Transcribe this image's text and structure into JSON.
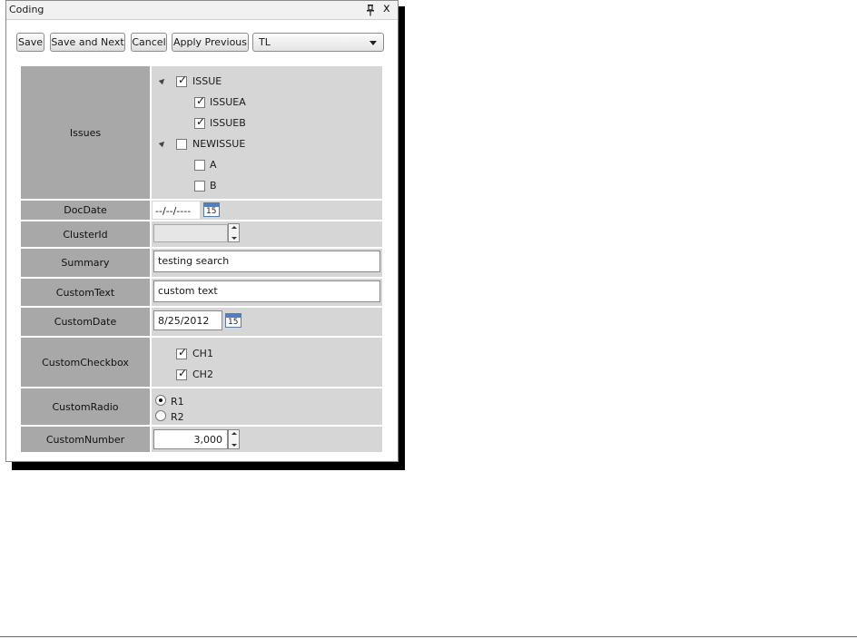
{
  "window": {
    "title": "Coding",
    "close_glyph": "x"
  },
  "toolbar": {
    "save_label": "Save",
    "save_next_label": "Save and Next",
    "cancel_label": "Cancel",
    "apply_previous_label": "Apply Previous",
    "dropdown_value": "TL"
  },
  "fields": {
    "issues": {
      "label": "Issues",
      "tree": [
        {
          "label": "ISSUE",
          "checked": true,
          "children": [
            {
              "label": "ISSUEA",
              "checked": true
            },
            {
              "label": "ISSUEB",
              "checked": true
            }
          ]
        },
        {
          "label": "NEWISSUE",
          "checked": false,
          "children": [
            {
              "label": "A",
              "checked": false
            },
            {
              "label": "B",
              "checked": false
            }
          ]
        }
      ]
    },
    "docdate": {
      "label": "DocDate",
      "value": "--/--/----",
      "calendar_day": "15"
    },
    "clusterid": {
      "label": "ClusterId",
      "value": ""
    },
    "summary": {
      "label": "Summary",
      "value": "testing search"
    },
    "customtext": {
      "label": "CustomText",
      "value": "custom text"
    },
    "customdate": {
      "label": "CustomDate",
      "value": "8/25/2012",
      "calendar_day": "15"
    },
    "customcheckbox": {
      "label": "CustomCheckbox",
      "options": [
        {
          "label": "CH1",
          "checked": true
        },
        {
          "label": "CH2",
          "checked": true
        }
      ]
    },
    "customradio": {
      "label": "CustomRadio",
      "options": [
        {
          "label": "R1",
          "selected": true
        },
        {
          "label": "R2",
          "selected": false
        }
      ]
    },
    "customnumber": {
      "label": "CustomNumber",
      "value": "3,000"
    }
  },
  "colors": {
    "label_bg": "#a8a8a8",
    "field_bg": "#d6d6d6",
    "calendar_accent": "#4f7fbf"
  }
}
